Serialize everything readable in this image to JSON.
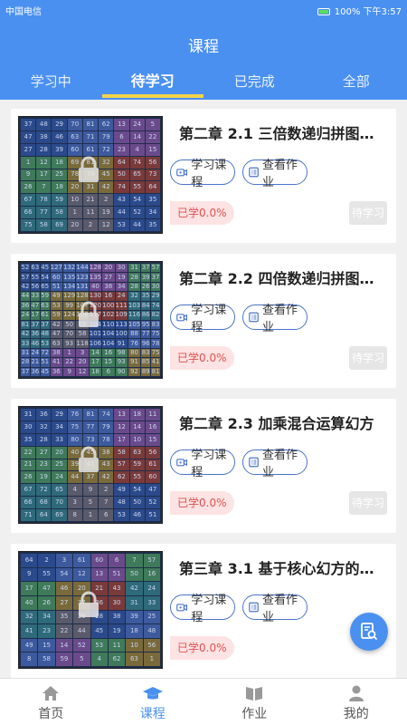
{
  "statusbar": {
    "carrier": "中国电信",
    "battery": "100%",
    "time": "下午3:57"
  },
  "header": {
    "title": "课程"
  },
  "tabs": [
    {
      "label": "学习中"
    },
    {
      "label": "待学习"
    },
    {
      "label": "已完成"
    },
    {
      "label": "全部"
    }
  ],
  "courses": [
    {
      "title": "第二章  2.1 三倍数递归拼图幻...",
      "study_label": "学习课程",
      "homework_label": "查看作业",
      "progress": "已学0.0%",
      "status": "待学习",
      "grid_size": 9,
      "numbers": [
        37,
        48,
        29,
        70,
        81,
        62,
        13,
        24,
        5,
        47,
        38,
        46,
        63,
        71,
        79,
        6,
        14,
        22,
        27,
        28,
        39,
        60,
        61,
        72,
        23,
        4,
        15,
        1,
        12,
        18,
        69,
        81,
        32,
        64,
        74,
        56,
        9,
        17,
        25,
        78,
        79,
        45,
        50,
        65,
        73,
        26,
        7,
        18,
        20,
        31,
        42,
        74,
        55,
        64,
        67,
        78,
        59,
        10,
        21,
        2,
        43,
        54,
        35,
        66,
        77,
        58,
        1,
        11,
        19,
        44,
        52,
        34,
        75,
        58,
        69,
        20,
        2,
        12,
        53,
        44,
        35
      ]
    },
    {
      "title": "第二章  2.2 四倍数递归拼图幻...",
      "study_label": "学习课程",
      "homework_label": "查看作业",
      "progress": "已学0.0%",
      "status": "待学习",
      "grid_size": 12,
      "numbers": [
        52,
        63,
        45,
        127,
        132,
        144,
        128,
        20,
        30,
        31,
        37,
        57,
        57,
        55,
        54,
        60,
        135,
        123,
        135,
        27,
        19,
        28,
        39,
        37,
        42,
        56,
        65,
        51,
        134,
        131,
        40,
        38,
        34,
        28,
        26,
        30,
        44,
        33,
        59,
        49,
        129,
        128,
        130,
        16,
        24,
        32,
        35,
        29,
        36,
        47,
        63,
        53,
        99,
        107,
        120,
        100,
        111,
        103,
        84,
        74,
        24,
        17,
        61,
        59,
        124,
        108,
        117,
        102,
        109,
        116,
        86,
        82,
        81,
        37,
        37,
        42,
        50,
        55,
        104,
        110,
        113,
        105,
        95,
        83,
        42,
        36,
        48,
        47,
        70,
        58,
        101,
        104,
        100,
        88,
        77,
        75,
        33,
        46,
        53,
        63,
        93,
        118,
        106,
        104,
        91,
        76,
        96,
        78,
        31,
        24,
        72,
        38,
        1,
        3,
        14,
        16,
        98,
        80,
        83,
        75,
        28,
        21,
        51,
        41,
        22,
        20,
        17,
        15,
        93,
        91,
        85,
        41,
        37,
        36,
        45,
        36,
        9,
        12,
        18,
        6,
        90,
        92,
        89,
        81
      ]
    },
    {
      "title": "第二章  2.3 加乘混合运算幻方",
      "study_label": "学习课程",
      "homework_label": "查看作业",
      "progress": "已学0.0%",
      "status": "待学习",
      "grid_size": 9,
      "numbers": [
        31,
        36,
        29,
        76,
        81,
        74,
        13,
        18,
        11,
        30,
        32,
        34,
        75,
        77,
        79,
        12,
        14,
        16,
        35,
        28,
        33,
        80,
        73,
        78,
        17,
        10,
        15,
        22,
        27,
        20,
        40,
        45,
        38,
        58,
        63,
        56,
        21,
        23,
        25,
        39,
        41,
        43,
        57,
        59,
        61,
        26,
        19,
        24,
        44,
        37,
        42,
        62,
        55,
        60,
        67,
        72,
        65,
        4,
        9,
        2,
        49,
        54,
        47,
        66,
        68,
        70,
        3,
        5,
        7,
        48,
        50,
        52,
        71,
        64,
        69,
        8,
        1,
        6,
        53,
        46,
        51
      ]
    },
    {
      "title": "第三章  3.1 基于核心幻方的矩...",
      "study_label": "学习课程",
      "homework_label": "查看作业",
      "progress": "已学0.0%",
      "status": "待学习",
      "grid_size": 8,
      "numbers": [
        64,
        2,
        3,
        61,
        60,
        6,
        7,
        57,
        9,
        55,
        54,
        12,
        13,
        51,
        50,
        16,
        17,
        47,
        46,
        20,
        21,
        43,
        42,
        24,
        40,
        26,
        27,
        37,
        36,
        30,
        31,
        33,
        32,
        34,
        35,
        29,
        28,
        38,
        39,
        25,
        41,
        23,
        22,
        44,
        45,
        19,
        18,
        48,
        49,
        15,
        14,
        52,
        53,
        11,
        10,
        56,
        8,
        58,
        59,
        5,
        4,
        62,
        63,
        1
      ]
    }
  ],
  "bottom_nav": [
    {
      "label": "首页",
      "icon": "home-icon"
    },
    {
      "label": "课程",
      "icon": "graduation-cap-icon"
    },
    {
      "label": "作业",
      "icon": "book-icon"
    },
    {
      "label": "我的",
      "icon": "user-icon"
    }
  ],
  "colors": {
    "primary": "#4a90f0",
    "tab_indicator": "#f3d34b",
    "progress_text": "#e05050",
    "progress_bg": "#fde3e3"
  }
}
